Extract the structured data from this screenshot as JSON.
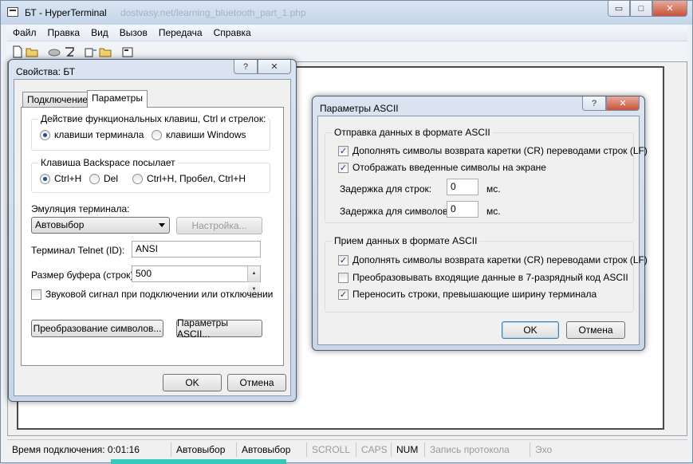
{
  "window": {
    "title": "БТ - HyperTerminal",
    "ghost_title": "dostvasy.net/learning_bluetooth_part_1.php",
    "minimize_glyph": "▭",
    "maximize_glyph": "□",
    "close_glyph": "✕"
  },
  "menu": [
    "Файл",
    "Правка",
    "Вид",
    "Вызов",
    "Передача",
    "Справка"
  ],
  "toolbar_icons": [
    "new-icon",
    "open-icon",
    "disconnect-icon",
    "dial-icon",
    "send-icon",
    "receive-icon",
    "properties-icon"
  ],
  "status": {
    "connect_time": "Время подключения: 0:01:16",
    "emulation": "Автовыбор",
    "detect": "Автовыбор",
    "scroll": "SCROLL",
    "caps": "CAPS",
    "num": "NUM",
    "capture": "Запись протокола",
    "echo": "Эхо"
  },
  "props": {
    "title": "Свойства: БТ",
    "help_glyph": "?",
    "close_glyph": "✕",
    "tabs": [
      "Подключение",
      "Параметры"
    ],
    "fkeys_group": "Действие функциональных клавиш, Ctrl и стрелок:",
    "fkeys_terminal": "клавиши терминала",
    "fkeys_windows": "клавиши Windows",
    "backspace_group": "Клавиша  Backspace посылает",
    "bs_ctrlh": "Ctrl+H",
    "bs_del": "Del",
    "bs_ctrlh_space": "Ctrl+H, Пробел, Ctrl+H",
    "emulation_label": "Эмуляция терминала:",
    "emulation_value": "Автовыбор",
    "setup_button": "Настройка...",
    "telnet_label": "Терминал Telnet (ID):",
    "telnet_value": "ANSI",
    "buffer_label": "Размер буфера (строк):",
    "buffer_value": "500",
    "sound_label": "Звуковой сигнал при подключении или отключении",
    "char_conv_button": "Преобразование символов...",
    "ascii_button": "Параметры ASCII...",
    "ok": "OK",
    "cancel": "Отмена"
  },
  "ascii": {
    "title": "Параметры ASCII",
    "help_glyph": "?",
    "close_glyph": "✕",
    "send_group": "Отправка данных в формате ASCII",
    "send_lf": "Дополнять символы возврата каретки (CR) переводами строк (LF)",
    "send_echo": "Отображать введенные символы на экране",
    "line_delay_label": "Задержка для строк:",
    "line_delay_value": "0",
    "char_delay_label": "Задержка для символов:",
    "char_delay_value": "0",
    "ms": "мс.",
    "recv_group": "Прием данных в формате ASCII",
    "recv_lf": "Дополнять символы возврата каретки (CR) переводами строк (LF)",
    "recv_7bit": "Преобразовывать входящие данные в 7-разрядный код ASCII",
    "recv_wrap": "Переносить строки, превышающие ширину терминала",
    "ok": "OK",
    "cancel": "Отмена",
    "check_glyph": "✓"
  }
}
